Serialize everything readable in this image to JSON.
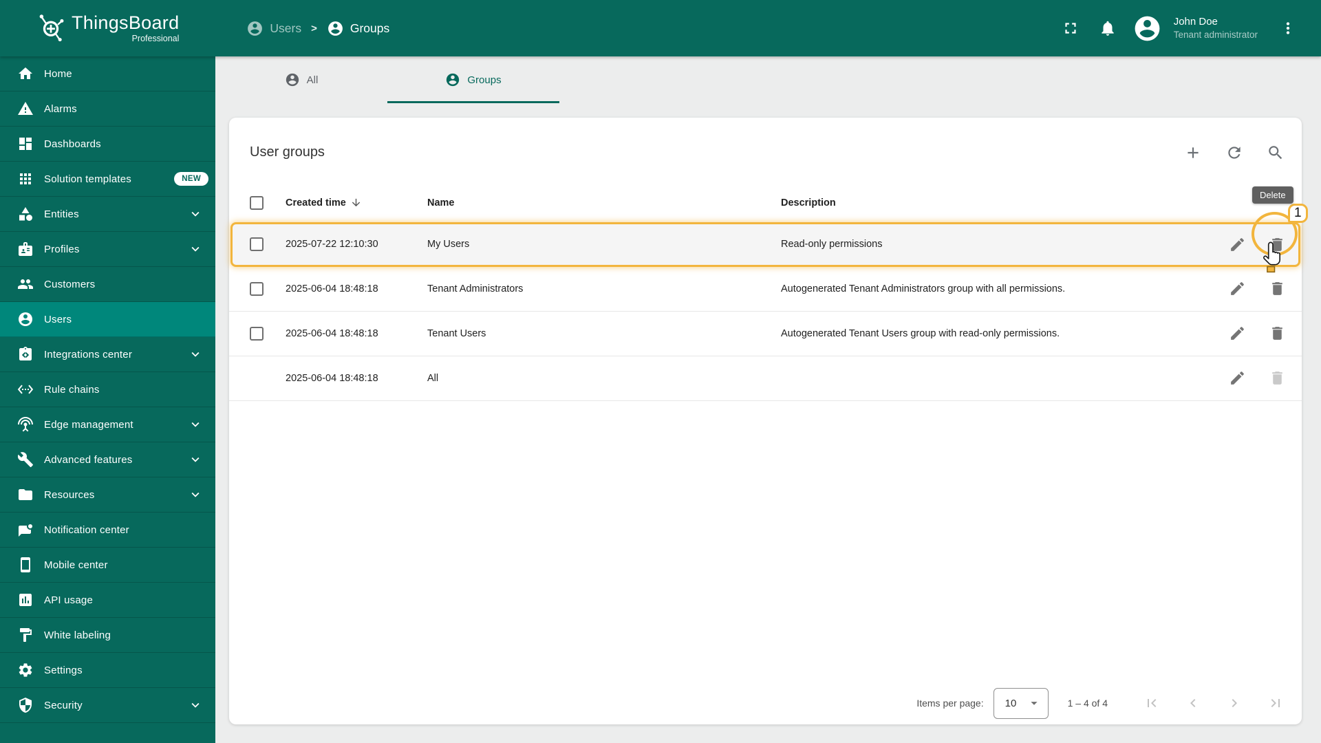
{
  "header": {
    "app_name": "ThingsBoard",
    "app_edition": "Professional",
    "breadcrumb": {
      "parent": "Users",
      "separator": ">",
      "current": "Groups"
    },
    "user": {
      "name": "John Doe",
      "role": "Tenant administrator"
    }
  },
  "sidebar": {
    "items": [
      {
        "label": "Home",
        "icon": "home-icon",
        "expandable": false,
        "active": false
      },
      {
        "label": "Alarms",
        "icon": "warning-icon",
        "expandable": false,
        "active": false
      },
      {
        "label": "Dashboards",
        "icon": "dashboards-icon",
        "expandable": false,
        "active": false
      },
      {
        "label": "Solution templates",
        "icon": "apps-icon",
        "expandable": false,
        "active": false,
        "badge": "NEW"
      },
      {
        "label": "Entities",
        "icon": "entities-icon",
        "expandable": true,
        "active": false
      },
      {
        "label": "Profiles",
        "icon": "profiles-icon",
        "expandable": true,
        "active": false
      },
      {
        "label": "Customers",
        "icon": "customers-icon",
        "expandable": false,
        "active": false
      },
      {
        "label": "Users",
        "icon": "user-account-icon",
        "expandable": false,
        "active": true
      },
      {
        "label": "Integrations center",
        "icon": "integrations-icon",
        "expandable": true,
        "active": false
      },
      {
        "label": "Rule chains",
        "icon": "rule-chains-icon",
        "expandable": false,
        "active": false
      },
      {
        "label": "Edge management",
        "icon": "edge-antenna-icon",
        "expandable": true,
        "active": false
      },
      {
        "label": "Advanced features",
        "icon": "advanced-features-icon",
        "expandable": true,
        "active": false
      },
      {
        "label": "Resources",
        "icon": "folder-icon",
        "expandable": true,
        "active": false
      },
      {
        "label": "Notification center",
        "icon": "notification-center-icon",
        "expandable": false,
        "active": false
      },
      {
        "label": "Mobile center",
        "icon": "mobile-icon",
        "expandable": false,
        "active": false
      },
      {
        "label": "API usage",
        "icon": "api-usage-icon",
        "expandable": false,
        "active": false
      },
      {
        "label": "White labeling",
        "icon": "white-labeling-icon",
        "expandable": false,
        "active": false
      },
      {
        "label": "Settings",
        "icon": "settings-gear-icon",
        "expandable": false,
        "active": false
      },
      {
        "label": "Security",
        "icon": "security-shield-icon",
        "expandable": true,
        "active": false
      }
    ]
  },
  "tabs": {
    "all": "All",
    "groups": "Groups"
  },
  "content": {
    "title": "User groups",
    "columns": {
      "created": "Created time",
      "name": "Name",
      "description": "Description"
    },
    "rows": [
      {
        "created": "2025-07-22 12:10:30",
        "name": "My Users",
        "description": "Read-only permissions",
        "has_checkbox": true,
        "highlighted": true,
        "delete_enabled": true
      },
      {
        "created": "2025-06-04 18:48:18",
        "name": "Tenant Administrators",
        "description": "Autogenerated Tenant Administrators group with all permissions.",
        "has_checkbox": true,
        "highlighted": false,
        "delete_enabled": true
      },
      {
        "created": "2025-06-04 18:48:18",
        "name": "Tenant Users",
        "description": "Autogenerated Tenant Users group with read-only permissions.",
        "has_checkbox": true,
        "highlighted": false,
        "delete_enabled": true
      },
      {
        "created": "2025-06-04 18:48:18",
        "name": "All",
        "description": "",
        "has_checkbox": false,
        "highlighted": false,
        "delete_enabled": false
      }
    ],
    "tooltip": "Delete",
    "annotation_step": "1"
  },
  "pagination": {
    "items_per_page_label": "Items per page:",
    "items_per_page": "10",
    "range": "1 – 4 of 4"
  },
  "colors": {
    "primary": "#07695c",
    "sidebar_active": "#00877b",
    "annotation_accent": "#f2b53d",
    "tooltip_bg": "#5f5f5f"
  }
}
